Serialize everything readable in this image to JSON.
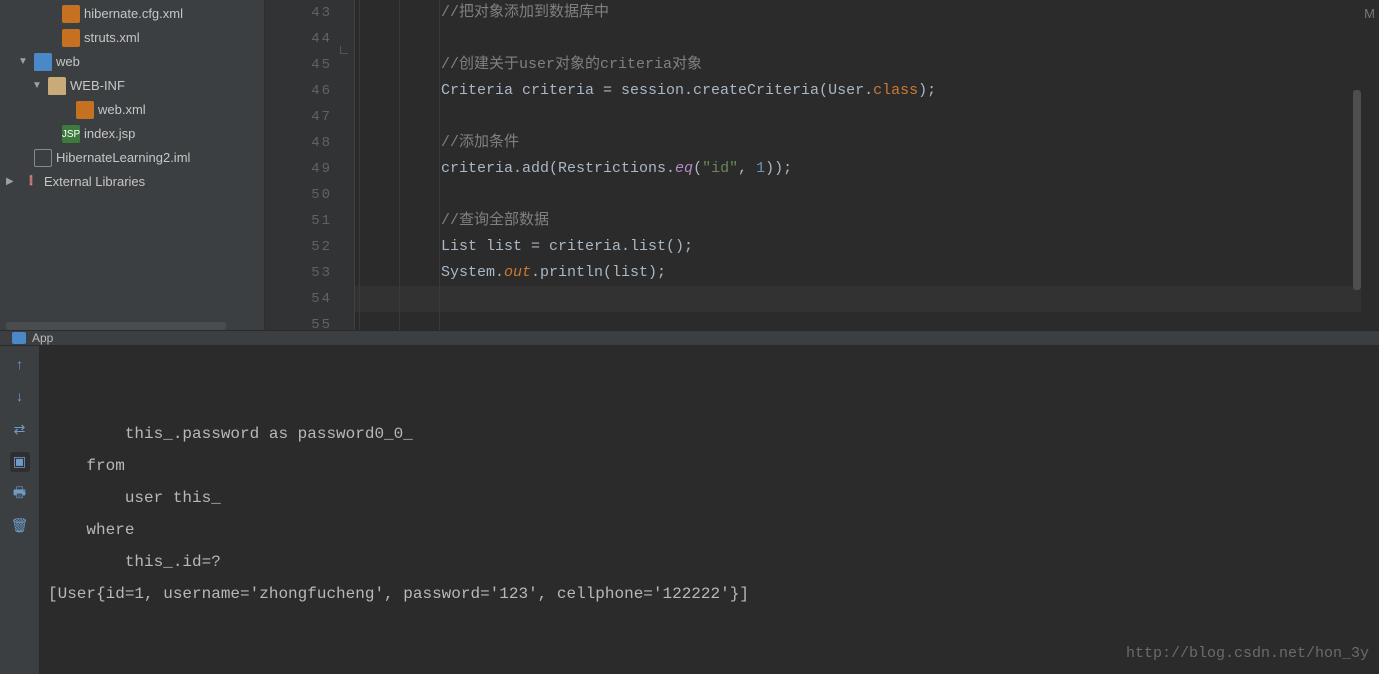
{
  "sidebar": {
    "items": [
      {
        "indent": 40,
        "arrow": "",
        "iconClass": "i-xml",
        "iconText": "",
        "label": "hibernate.cfg.xml"
      },
      {
        "indent": 40,
        "arrow": "",
        "iconClass": "i-xml",
        "iconText": "",
        "label": "struts.xml"
      },
      {
        "indent": 12,
        "arrow": "▼",
        "iconClass": "i-web",
        "iconText": "",
        "label": "web"
      },
      {
        "indent": 26,
        "arrow": "▼",
        "iconClass": "i-folder",
        "iconText": "",
        "label": "WEB-INF"
      },
      {
        "indent": 54,
        "arrow": "",
        "iconClass": "i-xml",
        "iconText": "",
        "label": "web.xml"
      },
      {
        "indent": 40,
        "arrow": "",
        "iconClass": "i-jsp",
        "iconText": "JSP",
        "label": "index.jsp"
      },
      {
        "indent": 12,
        "arrow": "",
        "iconClass": "i-iml",
        "iconText": "",
        "label": "HibernateLearning2.iml"
      },
      {
        "indent": 0,
        "arrow": "▶",
        "iconClass": "i-lib",
        "iconText": "⫿",
        "label": "External Libraries"
      }
    ]
  },
  "editor": {
    "lineStart": 43,
    "lineEnd": 55,
    "indentGuides": [
      4,
      44,
      84
    ],
    "currentLine": 54,
    "lines": [
      {
        "n": 43,
        "html": "<span class='c-comment'>//把对象添加到数据库中</span>"
      },
      {
        "n": 44,
        "html": ""
      },
      {
        "n": 45,
        "html": "<span class='c-comment'>//创建关于user对象的criteria对象</span>"
      },
      {
        "n": 46,
        "html": "<span class='c-plain'>Criteria criteria = session.createCriteria(User.</span><span class='c-kw'>class</span><span class='c-plain'>);</span>"
      },
      {
        "n": 47,
        "html": ""
      },
      {
        "n": 48,
        "html": "<span class='c-comment'>//添加条件</span>"
      },
      {
        "n": 49,
        "html": "<span class='c-plain'>criteria.add(Restrictions.</span><span class='c-staticf'>eq</span><span class='c-plain'>(</span><span class='c-str'>\"id\"</span><span class='c-plain'>, </span><span class='c-num'>1</span><span class='c-plain'>));</span>"
      },
      {
        "n": 50,
        "html": ""
      },
      {
        "n": 51,
        "html": "<span class='c-comment'>//查询全部数据</span>"
      },
      {
        "n": 52,
        "html": "<span class='c-plain'>List list = criteria.list();</span>"
      },
      {
        "n": 53,
        "html": "<span class='c-plain'>System.</span><span class='c-static'>out</span><span class='c-plain'>.println(list);</span>"
      },
      {
        "n": 54,
        "html": ""
      },
      {
        "n": 55,
        "html": ""
      }
    ]
  },
  "runTab": {
    "label": "App"
  },
  "console": {
    "lines": [
      "        this_.password as password0_0_ ",
      "    from",
      "        user this_ ",
      "    where",
      "        this_.id=?",
      "[User{id=1, username='zhongfucheng', password='123', cellphone='122222'}]"
    ]
  },
  "watermark": "http://blog.csdn.net/hon_3y",
  "toolIcons": {
    "up": "↑",
    "down": "↓",
    "wrap": "⇄",
    "img": "▣",
    "print": "🖶",
    "trash": "🗑"
  }
}
